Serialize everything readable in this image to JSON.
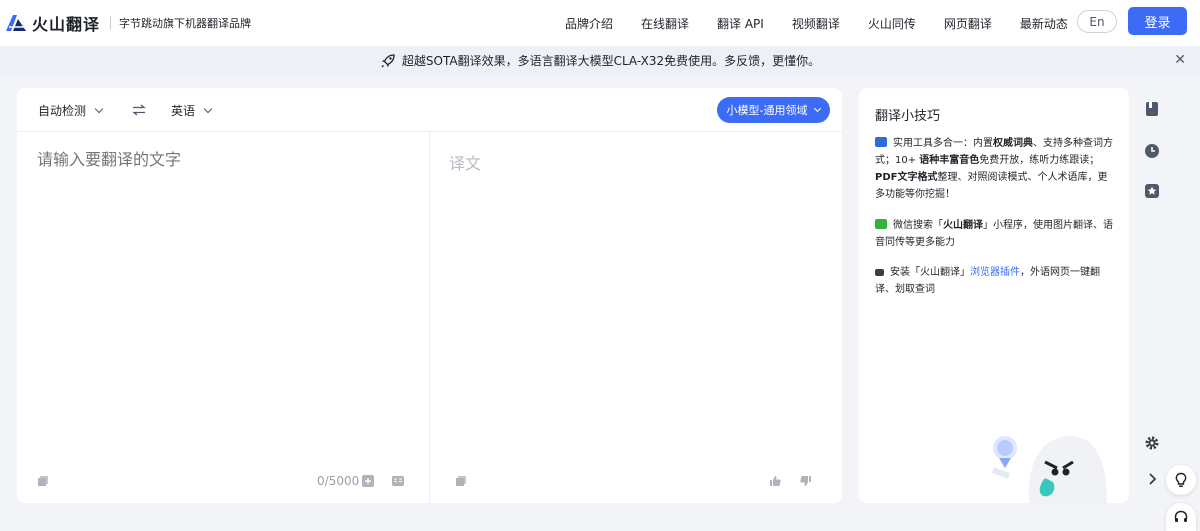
{
  "header": {
    "logo_text": "火山翻译",
    "slogan": "字节跳动旗下机器翻译品牌",
    "nav": [
      "品牌介绍",
      "在线翻译",
      "翻译 API",
      "视频翻译",
      "火山同传",
      "网页翻译",
      "最新动态"
    ],
    "lang_toggle": "En",
    "login_label": "登录"
  },
  "banner": {
    "text": "超越SOTA翻译效果，多语言翻译大模型CLA-X32免费使用。多反馈，更懂你。"
  },
  "translator": {
    "source_lang": "自动检测",
    "target_lang": "英语",
    "model_label": "小模型-通用领域",
    "source_placeholder": "请输入要翻译的文字",
    "target_placeholder": "译文",
    "counter": "0/5000"
  },
  "tips": {
    "title": "翻译小技巧",
    "tip1": {
      "a": "实用工具多合一：内置",
      "b": "权威词典",
      "c": "、支持多种查词方式；10+ ",
      "d": "语种丰富音色",
      "e": "免费开放，练听力练跟读；",
      "f": "PDF文字格式",
      "g": "整理、对照阅读模式、个人术语库，更多功能等你挖掘！"
    },
    "tip2": {
      "a": "微信搜索「",
      "b": "火山翻译",
      "c": "」小程序，使用图片翻译、语音同传等更多能力"
    },
    "tip3": {
      "a": "安装「火山翻译」",
      "b": "浏览器插件",
      "c": "，外语网页一键翻译、划取查词"
    }
  },
  "colors": {
    "accent": "#3c6cf6",
    "background": "#f3f4f8"
  }
}
